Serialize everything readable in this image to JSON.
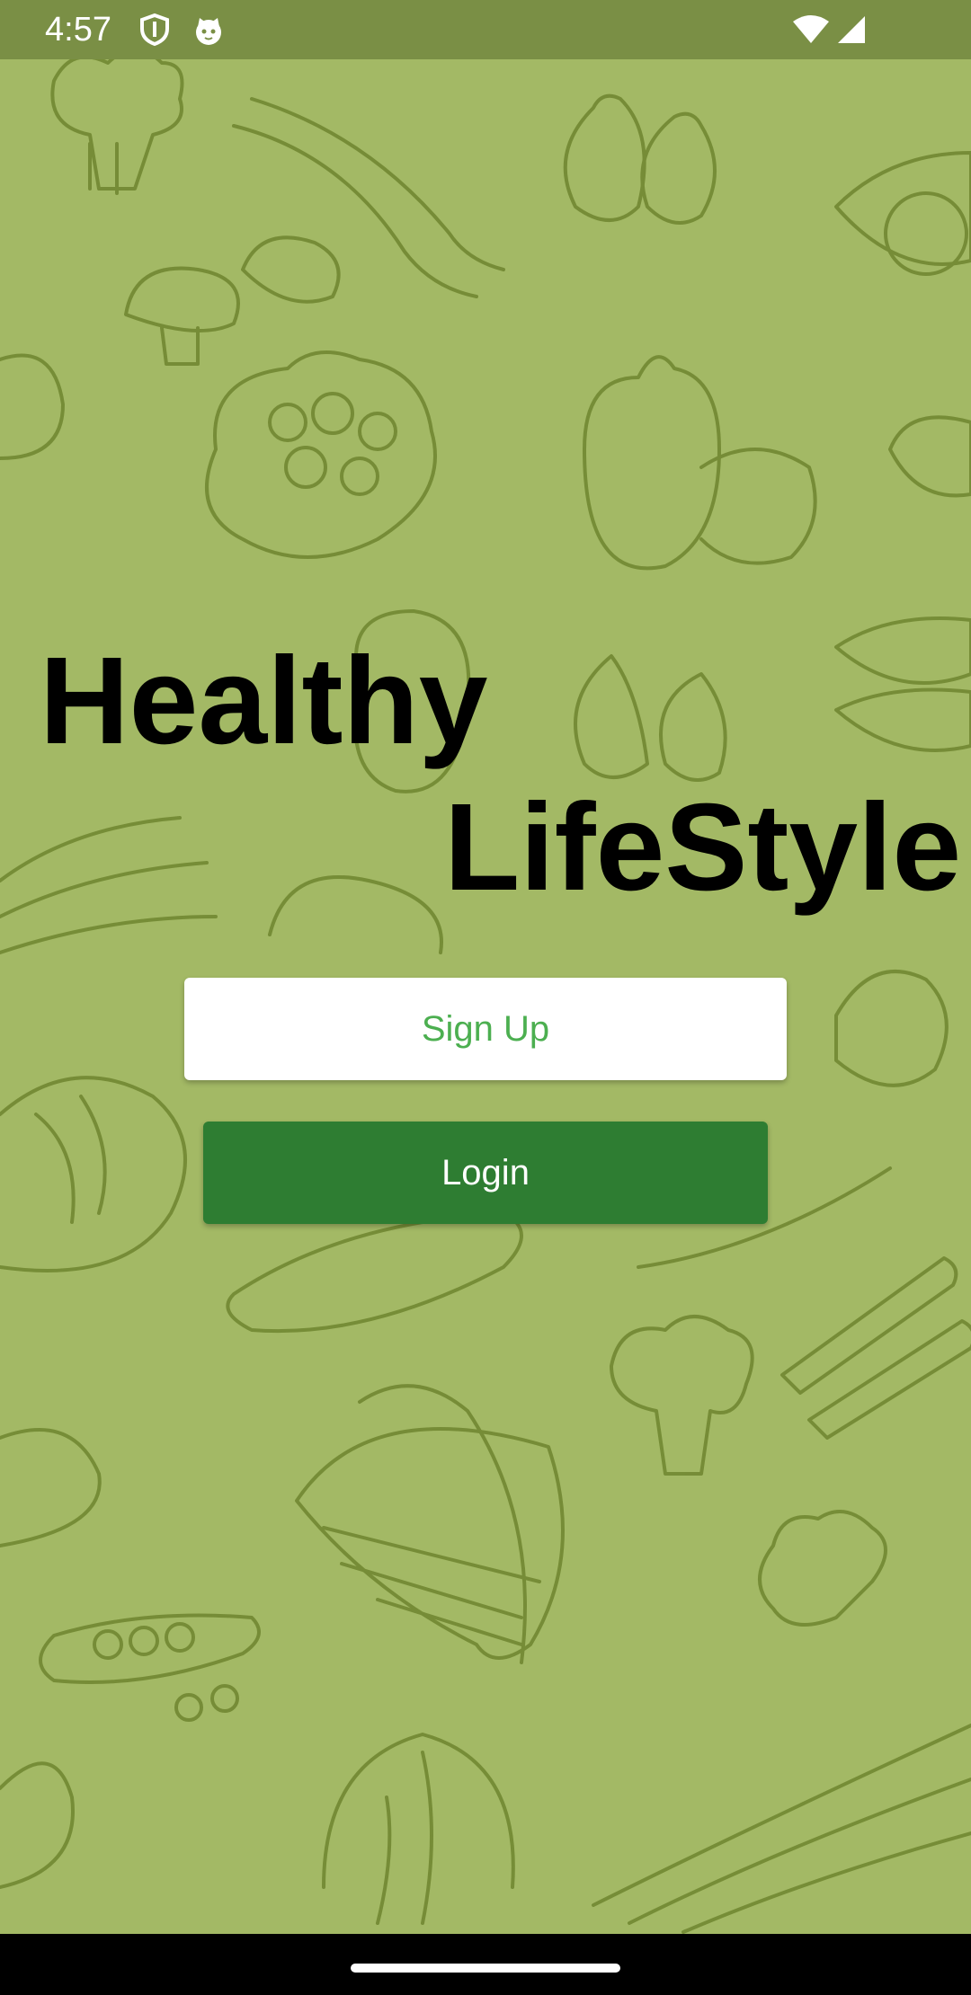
{
  "status_bar": {
    "time": "4:57",
    "icons": [
      "shield-icon",
      "cat-face-icon",
      "wifi-icon",
      "cell-signal-icon"
    ]
  },
  "title": {
    "line1": "Healthy",
    "line2": "LifeStyle"
  },
  "actions": {
    "signup_label": "Sign Up",
    "login_label": "Login"
  },
  "colors": {
    "background": "#a3b965",
    "status_bar": "#7a8f45",
    "signup_bg": "#ffffff",
    "signup_text": "#4caf50",
    "login_bg": "#2e7d32",
    "login_text": "#ffffff",
    "nav_bar": "#000000"
  },
  "background_art": "vegetable-doodle-pattern"
}
